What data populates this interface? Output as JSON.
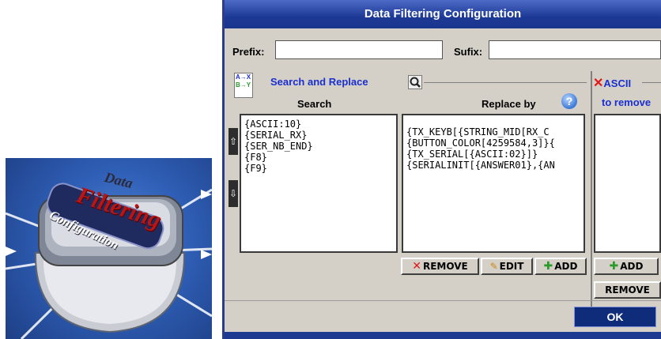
{
  "illustration": {
    "word_data": "Data",
    "word_filtering": "Filtering",
    "word_configuration": "Configuration"
  },
  "dialog": {
    "title": "Data Filtering Configuration",
    "prefix_label": "Prefix:",
    "prefix_value": "",
    "sufix_label": "Sufix:",
    "sufix_value": ""
  },
  "search_replace": {
    "title": "Search and Replace",
    "search_header": "Search",
    "replace_header": "Replace by",
    "search_items": [
      "{ASCII:10}",
      "{SERIAL_RX}",
      "{SER_NB_END}",
      "{F8}",
      "{F9}"
    ],
    "replace_items": [
      "",
      "{TX_KEYB[{STRING_MID[RX_C",
      "{BUTTON_COLOR[4259584,3]}{",
      "{TX_SERIAL[{ASCII:02}]}",
      "{SERIALINIT[{ANSWER01},{AN"
    ],
    "remove_label": "REMOVE",
    "edit_label": "EDIT",
    "add_label": "ADD"
  },
  "ascii": {
    "title": "ASCII",
    "subtitle": "to remove",
    "add_label": "ADD",
    "remove_label": "REMOVE"
  },
  "footer": {
    "ok_label": "OK"
  },
  "colors": {
    "title_bar": "#1c3996",
    "accent_blue": "#1a2fd0",
    "remove_red": "#e01818",
    "add_green": "#2b9a2b"
  }
}
